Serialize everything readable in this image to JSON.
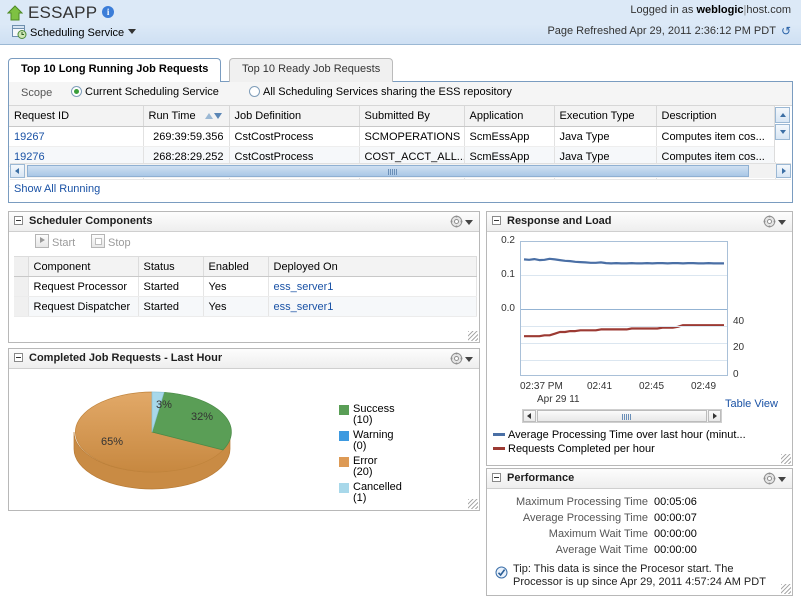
{
  "header": {
    "app_title": "ESSAPP",
    "info_icon": "info-icon",
    "home_icon": "home-icon",
    "service_label": "Scheduling Service",
    "service_icon": "scheduling-service-icon",
    "logged_in_prefix": "Logged in as",
    "logged_in_user": "weblogic",
    "host": "host.com",
    "page_refreshed": "Page Refreshed Apr 29, 2011 2:36:12 PM PDT",
    "refresh_icon": "refresh-icon"
  },
  "tabs": [
    {
      "label": "Top 10 Long Running Job Requests",
      "active": true
    },
    {
      "label": "Top 10 Ready Job Requests",
      "active": false
    }
  ],
  "scope": {
    "label": "Scope",
    "options": [
      {
        "label": "Current Scheduling Service",
        "selected": true
      },
      {
        "label": "All Scheduling Services sharing the ESS repository",
        "selected": false
      }
    ]
  },
  "requests_table": {
    "columns": [
      "Request ID",
      "Run Time",
      "Job Definition",
      "Submitted By",
      "Application",
      "Execution Type",
      "Description"
    ],
    "sort_column": "Run Time",
    "rows": [
      {
        "request_id": "19267",
        "run_time": "269:39:59.356",
        "job_definition": "CstCostProcess",
        "submitted_by": "SCMOPERATIONS",
        "application": "ScmEssApp",
        "execution_type": "Java Type",
        "description": "Computes item cos..."
      },
      {
        "request_id": "19276",
        "run_time": "268:28:29.252",
        "job_definition": "CstCostProcess",
        "submitted_by": "COST_ACCT_ALL...",
        "application": "ScmEssApp",
        "execution_type": "Java Type",
        "description": "Computes item cos..."
      }
    ],
    "show_all_link": "Show All Running"
  },
  "scheduler_components": {
    "title": "Scheduler Components",
    "start_label": "Start",
    "stop_label": "Stop",
    "columns": [
      "Component",
      "Status",
      "Enabled",
      "Deployed On"
    ],
    "rows": [
      {
        "component": "Request Processor",
        "status": "Started",
        "enabled": "Yes",
        "deployed_on": "ess_server1"
      },
      {
        "component": "Request Dispatcher",
        "status": "Started",
        "enabled": "Yes",
        "deployed_on": "ess_server1"
      }
    ]
  },
  "completed_jobs": {
    "title": "Completed Job Requests - Last Hour"
  },
  "response_and_load": {
    "title": "Response and Load",
    "table_view_link": "Table View"
  },
  "performance": {
    "title": "Performance",
    "metrics": [
      {
        "label": "Maximum Processing Time",
        "value": "00:05:06"
      },
      {
        "label": "Average Processing Time",
        "value": "00:00:07"
      },
      {
        "label": "Maximum Wait Time",
        "value": "00:00:00"
      },
      {
        "label": "Average Wait Time",
        "value": "00:00:00"
      }
    ],
    "tip_line1": "Tip: This data is since the Procesor start. The",
    "tip_line2": "Processor is up since Apr 29, 2011 4:57:24 AM PDT",
    "tip_icon": "tip-icon"
  },
  "chart_data": [
    {
      "type": "pie",
      "title": "Completed Job Requests - Last Hour",
      "labels": [
        "Success",
        "Warning",
        "Error",
        "Cancelled"
      ],
      "counts": [
        10,
        0,
        20,
        1
      ],
      "percent_labels": [
        "32%",
        "",
        "65%",
        "3%"
      ],
      "values": [
        32,
        0,
        65,
        3
      ],
      "colors": [
        "#5a9e56",
        "#3d9ae0",
        "#dd9a55",
        "#a8d8ea"
      ],
      "legend_position": "right",
      "legend_entries": [
        "Success (10)",
        "Warning (0)",
        "Error (20)",
        "Cancelled (1)"
      ]
    },
    {
      "type": "line",
      "title": "Response and Load",
      "xlabel": "Apr 29 11",
      "x_tick_labels": [
        "02:37 PM",
        "02:41",
        "02:45",
        "02:49"
      ],
      "y_left_ticks": [
        "0.2",
        "0.1",
        "0.0"
      ],
      "y_right_ticks": [
        "40",
        "20",
        "0"
      ],
      "ylim_left": [
        0.0,
        0.2
      ],
      "ylim_right": [
        0,
        40
      ],
      "grid": true,
      "series": [
        {
          "name": "Average Processing Time over last hour (minut...",
          "color": "#4a6fa5",
          "axis": "left",
          "values": [
            0.148,
            0.147,
            0.149,
            0.146,
            0.147,
            0.15,
            0.148,
            0.146,
            0.144,
            0.143,
            0.141,
            0.14,
            0.139,
            0.138,
            0.138,
            0.139,
            0.137,
            0.136,
            0.137,
            0.136,
            0.136,
            0.137,
            0.136,
            0.136,
            0.137,
            0.136,
            0.137,
            0.137,
            0.136,
            0.137,
            0.137,
            0.136,
            0.137,
            0.137,
            0.136,
            0.136,
            0.137,
            0.136,
            0.136,
            0.136
          ]
        },
        {
          "name": "Requests Completed per hour",
          "color": "#9c3a33",
          "axis": "right",
          "values": [
            28,
            28,
            28,
            28,
            29,
            29,
            31,
            33,
            33,
            34,
            34,
            35,
            35,
            35,
            35,
            36,
            36,
            36,
            36,
            36,
            36,
            37,
            37,
            37,
            37,
            37,
            37,
            38,
            38,
            38,
            39,
            41,
            41,
            41,
            41,
            41,
            41,
            41,
            41,
            41
          ]
        }
      ]
    }
  ]
}
